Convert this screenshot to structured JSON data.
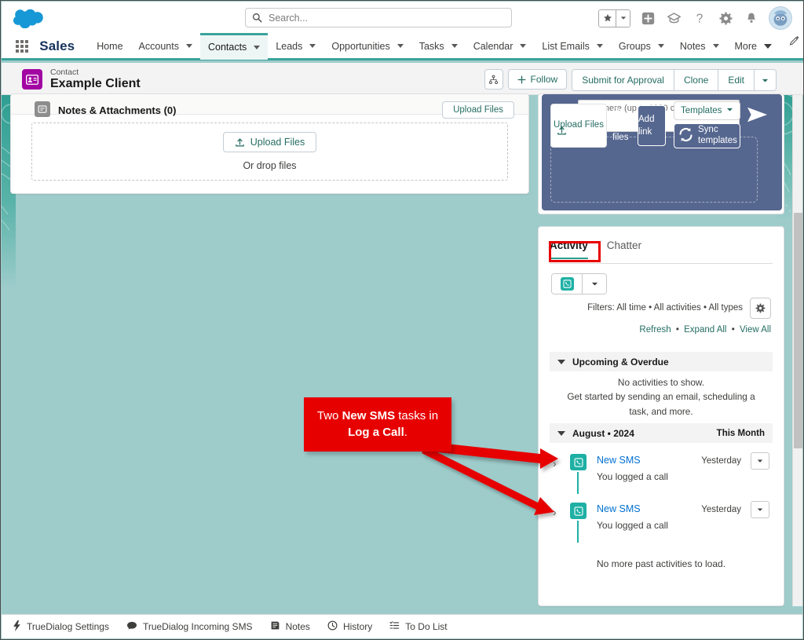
{
  "header": {
    "logo_icon": "salesforce-cloud-logo",
    "search_placeholder": "Search...",
    "search_icon": "search-icon",
    "icons": [
      {
        "name": "favorites-star-icon",
        "glyph": "★"
      },
      {
        "name": "favorites-dropdown-icon",
        "glyph": "▾"
      },
      {
        "name": "add-plus-icon",
        "glyph": "+"
      },
      {
        "name": "learning-hat-icon",
        "glyph": "◬"
      },
      {
        "name": "help-icon",
        "glyph": "?"
      },
      {
        "name": "setup-gear-icon",
        "glyph": "✿"
      },
      {
        "name": "notifications-bell-icon",
        "glyph": "🔔"
      },
      {
        "name": "user-avatar",
        "glyph": ""
      }
    ]
  },
  "nav": {
    "app_launcher_icon": "app-launcher-waffle-icon",
    "app_name": "Sales",
    "items": [
      {
        "label": "Home",
        "has_caret": false,
        "active": false
      },
      {
        "label": "Accounts",
        "has_caret": true,
        "active": false
      },
      {
        "label": "Contacts",
        "has_caret": true,
        "active": true
      },
      {
        "label": "Leads",
        "has_caret": true,
        "active": false
      },
      {
        "label": "Opportunities",
        "has_caret": true,
        "active": false
      },
      {
        "label": "Tasks",
        "has_caret": true,
        "active": false
      },
      {
        "label": "Calendar",
        "has_caret": true,
        "active": false
      },
      {
        "label": "List Emails",
        "has_caret": true,
        "active": false
      },
      {
        "label": "Groups",
        "has_caret": true,
        "active": false
      },
      {
        "label": "Notes",
        "has_caret": true,
        "active": false
      },
      {
        "label": "More",
        "has_caret": true,
        "active": false
      }
    ],
    "edit_icon": "pencil-edit-icon"
  },
  "record": {
    "type_label": "Contact",
    "title": "Example Client",
    "icon": "contact-card-icon",
    "hierarchy_icon": "org-hierarchy-icon",
    "follow_label": "Follow",
    "actions": [
      "Submit for Approval",
      "Clone",
      "Edit"
    ],
    "overflow_caret": "▾"
  },
  "notes_panel": {
    "icon": "notes-attachments-icon",
    "title": "Notes & Attachments (0)",
    "header_upload_label": "Upload Files",
    "upload_button_label": "Upload Files",
    "upload_icon": "upload-icon",
    "drop_label": "Or drop files"
  },
  "sms_composer": {
    "phone_icon": "sms-phone-icon",
    "textarea_placeholder": "Type here (up to 1000 characters)",
    "textarea_value": "",
    "send_icon": "send-paper-plane-icon",
    "upload_label": "Upload Files",
    "upload_icon": "upload-icon",
    "or_drop_label": "Or drop files",
    "add_link_label": "Add link",
    "templates_label": "Templates",
    "templates_caret": "▾",
    "sync_label": "Sync templates",
    "sync_icon": "sync-refresh-icon",
    "panel_color": "#56678f"
  },
  "activity": {
    "tabs": [
      {
        "label": "Activity",
        "active": true
      },
      {
        "label": "Chatter",
        "active": false
      }
    ],
    "compose_icon": "sms-compose-icon",
    "compose_caret": "▾",
    "filters_text": "Filters: All time • All activities • All types",
    "gear_icon": "filter-settings-gear-icon",
    "links": [
      "Refresh",
      "Expand All",
      "View All"
    ],
    "link_separator": "•",
    "sections": [
      {
        "title": "Upcoming & Overdue",
        "right_label": "",
        "empty_line_1": "No activities to show.",
        "empty_line_2": "Get started by sending an email, scheduling a task, and more."
      },
      {
        "title": "August • 2024",
        "right_label": "This Month"
      }
    ],
    "rows": [
      {
        "expand_icon": "chevron-right-icon",
        "icon": "log-a-call-sms-icon",
        "title": "New SMS",
        "subtitle": "You logged a call",
        "date": "Yesterday",
        "menu_caret": "▾"
      },
      {
        "expand_icon": "chevron-right-icon",
        "icon": "log-a-call-sms-icon",
        "title": "New SMS",
        "subtitle": "You logged a call",
        "date": "Yesterday",
        "menu_caret": "▾"
      }
    ],
    "footer_text": "No more past activities to load."
  },
  "annotation": {
    "text_part_1": "Two ",
    "text_bold_1": "New SMS",
    "text_part_2": " tasks in ",
    "text_bold_2": "Log a Call",
    "text_part_3": ".",
    "color": "#e60000"
  },
  "utility_bar": {
    "items": [
      {
        "label": "TrueDialog Settings",
        "icon": "lightning-bolt-icon",
        "glyph": "⚡"
      },
      {
        "label": "TrueDialog Incoming SMS",
        "icon": "chat-bubble-icon",
        "glyph": "💬"
      },
      {
        "label": "Notes",
        "icon": "notes-icon",
        "glyph": "📝"
      },
      {
        "label": "History",
        "icon": "clock-history-icon",
        "glyph": "🕐"
      },
      {
        "label": "To Do List",
        "icon": "todo-list-icon",
        "glyph": "☰"
      }
    ]
  },
  "colors": {
    "page_background": "#9ecccb",
    "brand_teal": "#2e9e91",
    "link_blue": "#0070d2",
    "action_green": "#246d62",
    "sms_panel": "#56678f",
    "annotation_red": "#e60000",
    "record_icon_purple": "#a205a2"
  }
}
